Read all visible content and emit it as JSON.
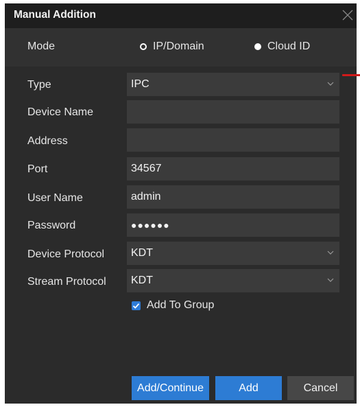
{
  "dialog": {
    "title": "Manual Addition"
  },
  "mode": {
    "label": "Mode",
    "options": [
      {
        "label": "IP/Domain",
        "selected": false
      },
      {
        "label": "Cloud ID",
        "selected": true
      }
    ]
  },
  "form": {
    "type_label": "Type",
    "type_value": "IPC",
    "device_name_label": "Device Name",
    "device_name_value": "",
    "address_label": "Address",
    "address_value": "",
    "port_label": "Port",
    "port_value": "34567",
    "user_name_label": "User Name",
    "user_name_value": "admin",
    "password_label": "Password",
    "password_value": "●●●●●●",
    "device_protocol_label": "Device Protocol",
    "device_protocol_value": "KDT",
    "stream_protocol_label": "Stream Protocol",
    "stream_protocol_value": "KDT"
  },
  "add_to_group": {
    "label": "Add To Group",
    "checked": true
  },
  "buttons": {
    "add_continue": "Add/Continue",
    "add": "Add",
    "cancel": "Cancel"
  },
  "colors": {
    "accent": "#2d7cd4",
    "background": "#2b2b2b",
    "field": "#3b3b3b",
    "marker": "#d11a1a"
  },
  "icons": {
    "close": "close-icon",
    "dropdown": "chevron-down-icon",
    "checkbox": "checkmark-icon"
  }
}
